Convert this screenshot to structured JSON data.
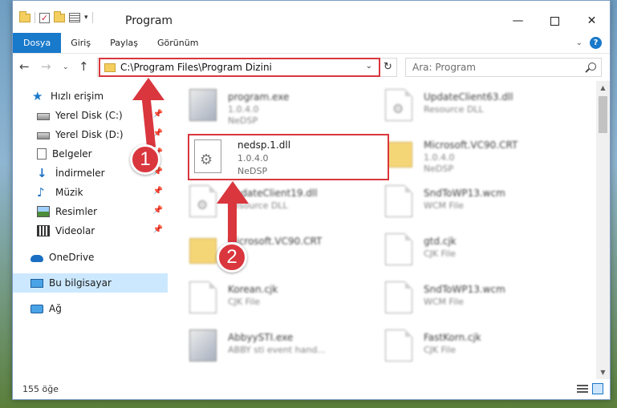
{
  "window": {
    "title": "Program",
    "min_glyph": "—",
    "close_glyph": "✕"
  },
  "ribbon": {
    "tabs": [
      {
        "label": "Dosya",
        "active": true
      },
      {
        "label": "Giriş"
      },
      {
        "label": "Paylaş"
      },
      {
        "label": "Görünüm"
      }
    ],
    "chevron": "⌄",
    "help": "?"
  },
  "nav": {
    "back": "←",
    "forward": "→",
    "recent": "⌄",
    "up": "↑",
    "address": "C:\\Program Files\\Program Dizini",
    "address_drop": "⌄",
    "refresh": "↻",
    "search_placeholder": "Ara: Program"
  },
  "sidebar": {
    "items": [
      {
        "label": "Hızlı erişim",
        "icon": "star-icon"
      },
      {
        "label": "Yerel Disk (C:)",
        "icon": "disk-icon",
        "pinned": true
      },
      {
        "label": "Yerel Disk (D:)",
        "icon": "disk-icon",
        "pinned": true
      },
      {
        "label": "Belgeler",
        "icon": "document-icon",
        "pinned": true
      },
      {
        "label": "İndirmeler",
        "icon": "download-icon",
        "pinned": true
      },
      {
        "label": "Müzik",
        "icon": "music-icon",
        "pinned": true
      },
      {
        "label": "Resimler",
        "icon": "pictures-icon",
        "pinned": true
      },
      {
        "label": "Videolar",
        "icon": "video-icon",
        "pinned": true
      },
      {
        "label": "OneDrive",
        "icon": "cloud-icon"
      },
      {
        "label": "Bu bilgisayar",
        "icon": "computer-icon",
        "selected": true
      },
      {
        "label": "Ağ",
        "icon": "network-icon"
      }
    ],
    "pin_glyph": "📌"
  },
  "files": {
    "left": [
      {
        "name": "program.exe",
        "line1": "1.0.4.0",
        "line2": "NeDSP"
      },
      {
        "name": "UpdateClient19.dll",
        "line1": "Resource DLL",
        "line2": ""
      },
      {
        "name": "Microsoft.VC90.CRT",
        "line1": "",
        "line2": ""
      },
      {
        "name": "Korean.cjk",
        "line1": "CJK File",
        "line2": ""
      },
      {
        "name": "AbbyySTI.exe",
        "line1": "ABBY sti event hand...",
        "line2": ""
      }
    ],
    "right": [
      {
        "name": "UpdateClient63.dll",
        "line1": "Resource DLL",
        "line2": ""
      },
      {
        "name": "Microsoft.VC90.CRT",
        "line1": "1.0.4.0",
        "line2": "NeDSP"
      },
      {
        "name": "SndToWP13.wcm",
        "line1": "WCM File",
        "line2": ""
      },
      {
        "name": "gtd.cjk",
        "line1": "CJK File",
        "line2": ""
      },
      {
        "name": "SndToWP13.wcm",
        "line1": "WCM File",
        "line2": ""
      },
      {
        "name": "FastKorn.cjk",
        "line1": "CJK File",
        "line2": ""
      }
    ],
    "highlighted": {
      "name": "nedsp.1.dll",
      "version": "1.0.4.0",
      "company": "NeDSP"
    }
  },
  "status": {
    "count": "155 öğe"
  },
  "annotations": {
    "badge1": "1",
    "badge2": "2"
  },
  "colors": {
    "accent": "#1979ca",
    "highlight": "#d9363e",
    "selected": "#cce8ff"
  }
}
